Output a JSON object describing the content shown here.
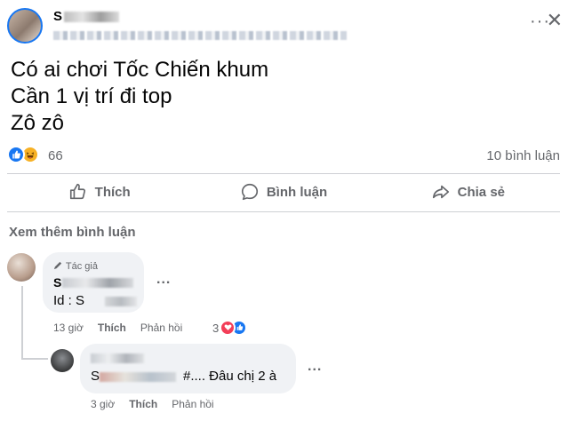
{
  "post": {
    "author_name": "S",
    "meta_tail": "",
    "more_label": "···",
    "close_label": "✕",
    "lines": [
      "Có ai chơi Tốc Chiến khum",
      "Cần 1 vị trí đi top",
      "Zô zô"
    ],
    "reaction_count": "66",
    "comment_count": "10 bình luận"
  },
  "actions": {
    "like": "Thích",
    "comment": "Bình luận",
    "share": "Chia sẻ"
  },
  "comments_section": {
    "see_more": "Xem thêm bình luận"
  },
  "comments": [
    {
      "badge": "Tác giả",
      "name_prefix": "S",
      "text_line1": "",
      "text_line2": "Id : S",
      "dots": "...",
      "time": "13 giờ",
      "like_label": "Thích",
      "reply_label": "Phản hồi",
      "reaction_count": "3"
    },
    {
      "name_prefix": "",
      "text_suffix": "#.... Đâu chị 2 à",
      "text_prefix": "S",
      "dots": "...",
      "time": "3 giờ",
      "like_label": "Thích",
      "reply_label": "Phản hồi"
    }
  ]
}
